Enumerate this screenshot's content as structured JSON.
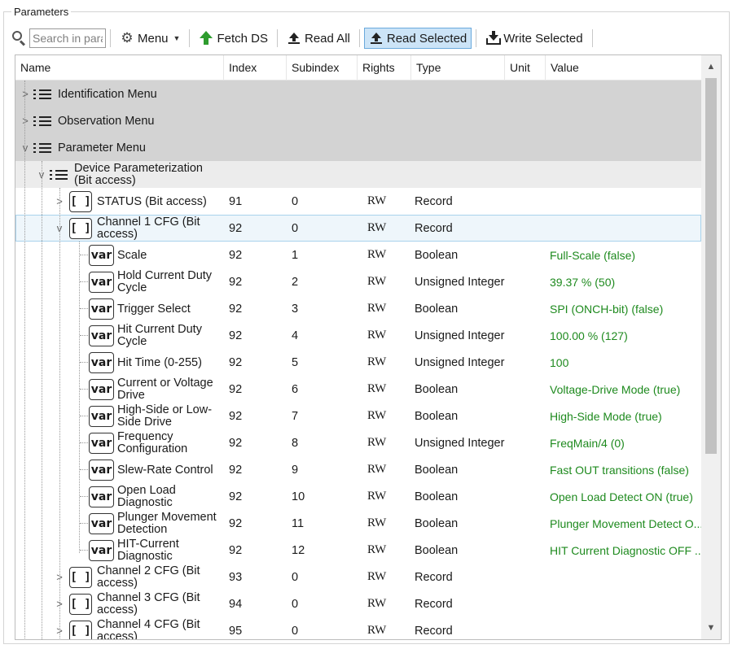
{
  "group_title": "Parameters",
  "toolbar": {
    "search_placeholder": "Search in parameters",
    "menu_label": "Menu",
    "fetch_label": "Fetch DS",
    "read_all_label": "Read All",
    "read_selected_label": "Read Selected",
    "write_selected_label": "Write Selected"
  },
  "columns": [
    "Name",
    "Index",
    "Subindex",
    "Rights",
    "Type",
    "Unit",
    "Value"
  ],
  "menus": [
    {
      "label": "Identification Menu",
      "expander": ">"
    },
    {
      "label": "Observation Menu",
      "expander": ">"
    },
    {
      "label": "Parameter Menu",
      "expander": "v"
    }
  ],
  "device_group": {
    "label": "Device Parameterization (Bit access)",
    "expander": "v"
  },
  "records": [
    {
      "name": "STATUS (Bit access)",
      "index": "91",
      "subindex": "0",
      "rights": "RW",
      "type": "Record",
      "icon": "[ ]",
      "expander": ">"
    },
    {
      "name": "Channel 1 CFG (Bit access)",
      "index": "92",
      "subindex": "0",
      "rights": "RW",
      "type": "Record",
      "icon": "[ ]",
      "expander": "v"
    }
  ],
  "vars": [
    {
      "name": "Scale",
      "index": "92",
      "subindex": "1",
      "rights": "RW",
      "type": "Boolean",
      "value": "Full-Scale (false)"
    },
    {
      "name": "Hold Current Duty Cycle",
      "index": "92",
      "subindex": "2",
      "rights": "RW",
      "type": "Unsigned Integer",
      "value": "39.37 % (50)"
    },
    {
      "name": "Trigger Select",
      "index": "92",
      "subindex": "3",
      "rights": "RW",
      "type": "Boolean",
      "value": "SPI (ONCH-bit) (false)"
    },
    {
      "name": "Hit Current Duty Cycle",
      "index": "92",
      "subindex": "4",
      "rights": "RW",
      "type": "Unsigned Integer",
      "value": "100.00 % (127)"
    },
    {
      "name": "Hit Time (0-255)",
      "index": "92",
      "subindex": "5",
      "rights": "RW",
      "type": "Unsigned Integer",
      "value": "100"
    },
    {
      "name": "Current or Voltage Drive",
      "index": "92",
      "subindex": "6",
      "rights": "RW",
      "type": "Boolean",
      "value": "Voltage-Drive Mode (true)"
    },
    {
      "name": "High-Side or Low-Side Drive",
      "index": "92",
      "subindex": "7",
      "rights": "RW",
      "type": "Boolean",
      "value": "High-Side Mode (true)"
    },
    {
      "name": "Frequency Configuration",
      "index": "92",
      "subindex": "8",
      "rights": "RW",
      "type": "Unsigned Integer",
      "value": "FreqMain/4 (0)"
    },
    {
      "name": "Slew-Rate Control",
      "index": "92",
      "subindex": "9",
      "rights": "RW",
      "type": "Boolean",
      "value": "Fast OUT transitions (false)"
    },
    {
      "name": "Open Load Diagnostic",
      "index": "92",
      "subindex": "10",
      "rights": "RW",
      "type": "Boolean",
      "value": "Open Load Detect ON (true)"
    },
    {
      "name": "Plunger Movement Detection",
      "index": "92",
      "subindex": "11",
      "rights": "RW",
      "type": "Boolean",
      "value": "Plunger Movement Detect O..."
    },
    {
      "name": "HIT-Current Diagnostic",
      "index": "92",
      "subindex": "12",
      "rights": "RW",
      "type": "Boolean",
      "value": "HIT Current Diagnostic OFF ..."
    }
  ],
  "more_records": [
    {
      "name": "Channel 2 CFG (Bit access)",
      "index": "93",
      "subindex": "0",
      "rights": "RW",
      "type": "Record",
      "icon": "[ ]",
      "expander": ">"
    },
    {
      "name": "Channel 3 CFG (Bit access)",
      "index": "94",
      "subindex": "0",
      "rights": "RW",
      "type": "Record",
      "icon": "[ ]",
      "expander": ">"
    },
    {
      "name": "Channel 4 CFG (Bit access)",
      "index": "95",
      "subindex": "0",
      "rights": "RW",
      "type": "Record",
      "icon": "[ ]",
      "expander": ">"
    }
  ],
  "var_icon_label": "var",
  "scroll": {
    "up": "▲",
    "down": "▼"
  }
}
